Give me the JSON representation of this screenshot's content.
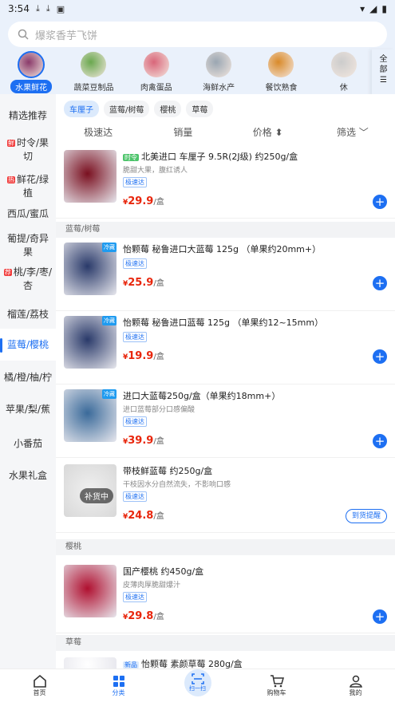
{
  "status": {
    "time": "3:54"
  },
  "search": {
    "placeholder": "爆浆香芋飞饼"
  },
  "categories": [
    {
      "label": "水果鲜花",
      "color": "#8a3a6a"
    },
    {
      "label": "蔬菜豆制品",
      "color": "#6aa84f"
    },
    {
      "label": "肉禽蛋品",
      "color": "#d9667a"
    },
    {
      "label": "海鲜水产",
      "color": "#9aa6b2"
    },
    {
      "label": "餐饮熟食",
      "color": "#d98a2a"
    },
    {
      "label": "休",
      "color": "#cccccc"
    }
  ],
  "all_button": "全部",
  "sidebar": [
    {
      "label": "精选推荐",
      "tag": ""
    },
    {
      "label": "时令/果切",
      "tag": "鲜"
    },
    {
      "label": "鲜花/绿植",
      "tag": "热"
    },
    {
      "label": "西瓜/蜜瓜",
      "tag": ""
    },
    {
      "label": "葡提/奇异果",
      "tag": ""
    },
    {
      "label": "桃/李/枣/杏",
      "tag": "荐"
    },
    {
      "label": "榴莲/荔枝",
      "tag": ""
    },
    {
      "label": "蓝莓/樱桃",
      "tag": ""
    },
    {
      "label": "橘/橙/柚/柠",
      "tag": ""
    },
    {
      "label": "苹果/梨/蕉",
      "tag": ""
    },
    {
      "label": "小番茄",
      "tag": ""
    },
    {
      "label": "水果礼盒",
      "tag": ""
    }
  ],
  "chips": [
    "车厘子",
    "蓝莓/树莓",
    "樱桃",
    "草莓"
  ],
  "sorts": [
    "极速达",
    "销量",
    "价格 ⬍",
    "筛选 ﹀"
  ],
  "sections": {
    "blueberry": "蓝莓/树莓",
    "cherry": "樱桃",
    "strawberry": "草莓"
  },
  "products": [
    {
      "tag": "时令",
      "title": "北美进口 车厘子 9.5R(2J级) 约250g/盒",
      "sub": "脆甜大果，腹红诱人",
      "badge": "极速达",
      "price": "29.9",
      "unit": "/盒",
      "img": "#7a1020"
    },
    {
      "cold": "冷藏",
      "title": "怡颗莓 秘鲁进口大蓝莓 125g （单果约20mm+）",
      "badge": "极速达",
      "price": "25.9",
      "unit": "/盒",
      "img": "#2a3a6a"
    },
    {
      "cold": "冷藏",
      "title": "怡颗莓 秘鲁进口蓝莓 125g （单果约12~15mm）",
      "badge": "极速达",
      "price": "19.9",
      "unit": "/盒",
      "img": "#2a3a6a"
    },
    {
      "cold": "冷藏",
      "title": "进口大蓝莓250g/盒（单果约18mm+）",
      "sub": "进口蓝莓部分口感偏酸",
      "badge": "极速达",
      "price": "39.9",
      "unit": "/盒",
      "img": "#3a6a9a"
    },
    {
      "title": "带枝鲜蓝莓 约250g/盒",
      "sub": "干枝因水分自然流失，不影响口感",
      "badge": "极速达",
      "price": "24.8",
      "unit": "/盒",
      "img": "#dddddd",
      "restock": "补货中",
      "notify": "到货提醒"
    },
    {
      "title": "国产樱桃 约450g/盒",
      "sub": "皮薄肉厚脆甜爆汁",
      "badge": "极速达",
      "price": "29.8",
      "unit": "/盒",
      "img": "#b01030"
    },
    {
      "tag": "新品",
      "title": "怡颗莓 素颜草莓 280g/盒",
      "price": "",
      "img": "#ffffff"
    }
  ],
  "tabbar": [
    "首页",
    "分类",
    "扫一扫",
    "购物车",
    "我的"
  ]
}
